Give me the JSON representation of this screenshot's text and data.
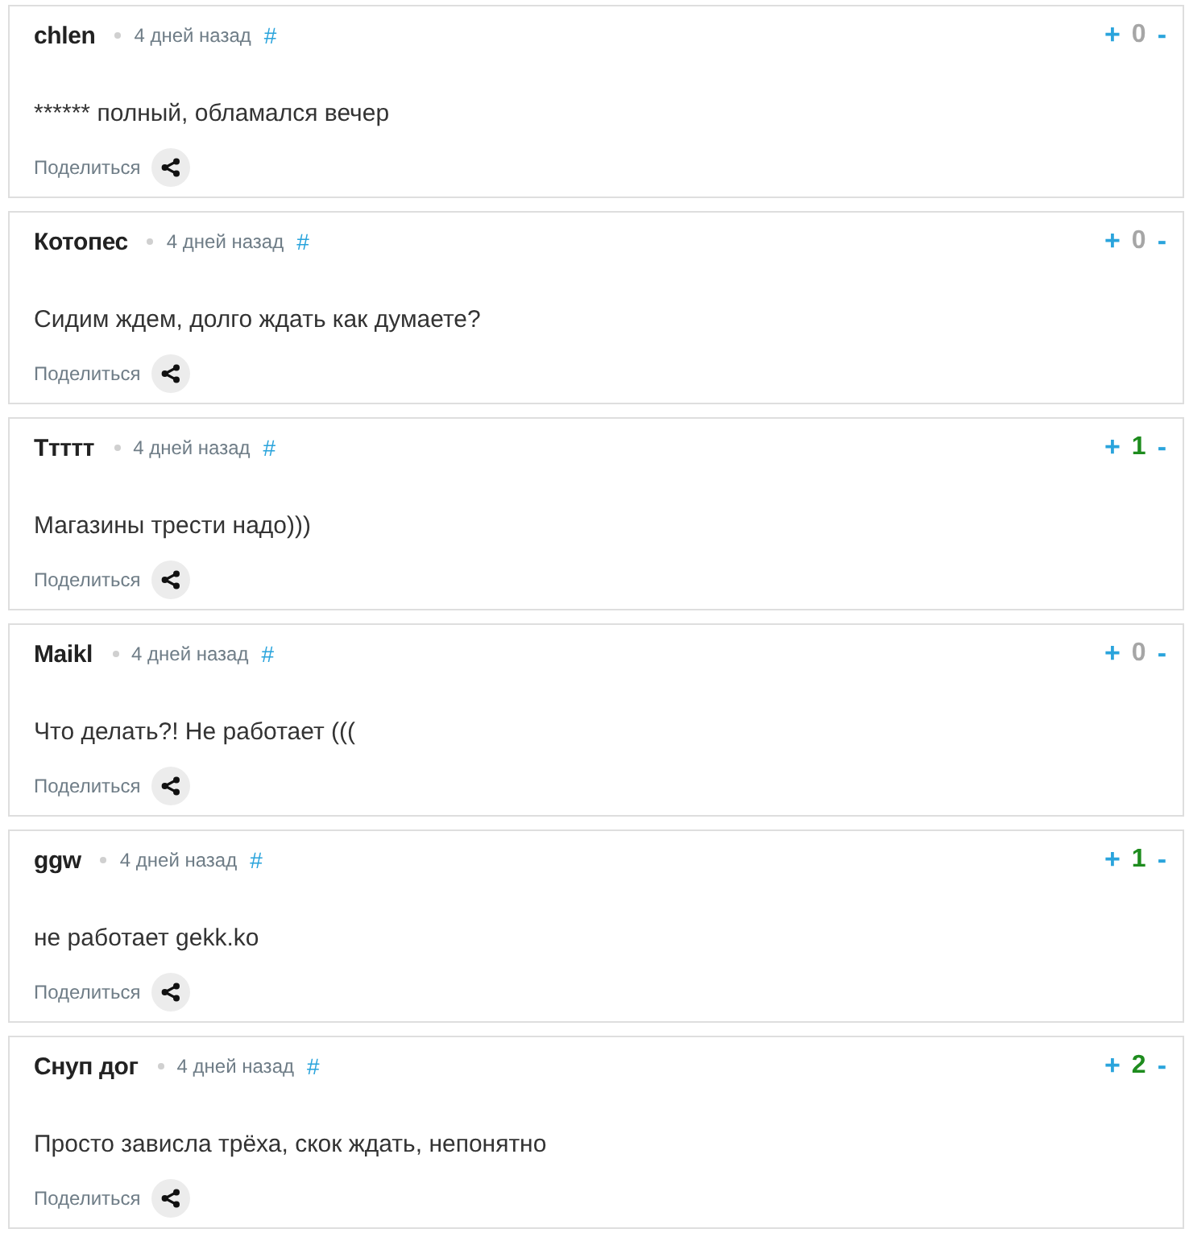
{
  "comments": [
    {
      "author": "chlen",
      "time": "4 дней назад",
      "anchor": "#",
      "text": "****** полный, обламался вечер",
      "share": "Поделиться",
      "rating": {
        "plus": "+",
        "value": "0",
        "minus": "-",
        "color": "#a6a6a6"
      }
    },
    {
      "author": "Котопес",
      "time": "4 дней назад",
      "anchor": "#",
      "text": "Сидим ждем, долго ждать как думаете?",
      "share": "Поделиться",
      "rating": {
        "plus": "+",
        "value": "0",
        "minus": "-",
        "color": "#a6a6a6"
      }
    },
    {
      "author": "Ттттт",
      "time": "4 дней назад",
      "anchor": "#",
      "text": "Магазины трести надо)))",
      "share": "Поделиться",
      "rating": {
        "plus": "+",
        "value": "1",
        "minus": "-",
        "color": "#1e8c1e"
      }
    },
    {
      "author": "Maikl",
      "time": "4 дней назад",
      "anchor": "#",
      "text": "Что делать?! Не работает (((",
      "share": "Поделиться",
      "rating": {
        "plus": "+",
        "value": "0",
        "minus": "-",
        "color": "#a6a6a6"
      }
    },
    {
      "author": "ggw",
      "time": "4 дней назад",
      "anchor": "#",
      "text": "не работает gekk.ko",
      "share": "Поделиться",
      "rating": {
        "plus": "+",
        "value": "1",
        "minus": "-",
        "color": "#1e8c1e"
      }
    },
    {
      "author": "Снуп дог",
      "time": "4 дней назад",
      "anchor": "#",
      "text": "Просто зависла трёха, скок ждать, непонятно",
      "share": "Поделиться",
      "rating": {
        "plus": "+",
        "value": "2",
        "minus": "-",
        "color": "#1e8c1e"
      }
    }
  ]
}
